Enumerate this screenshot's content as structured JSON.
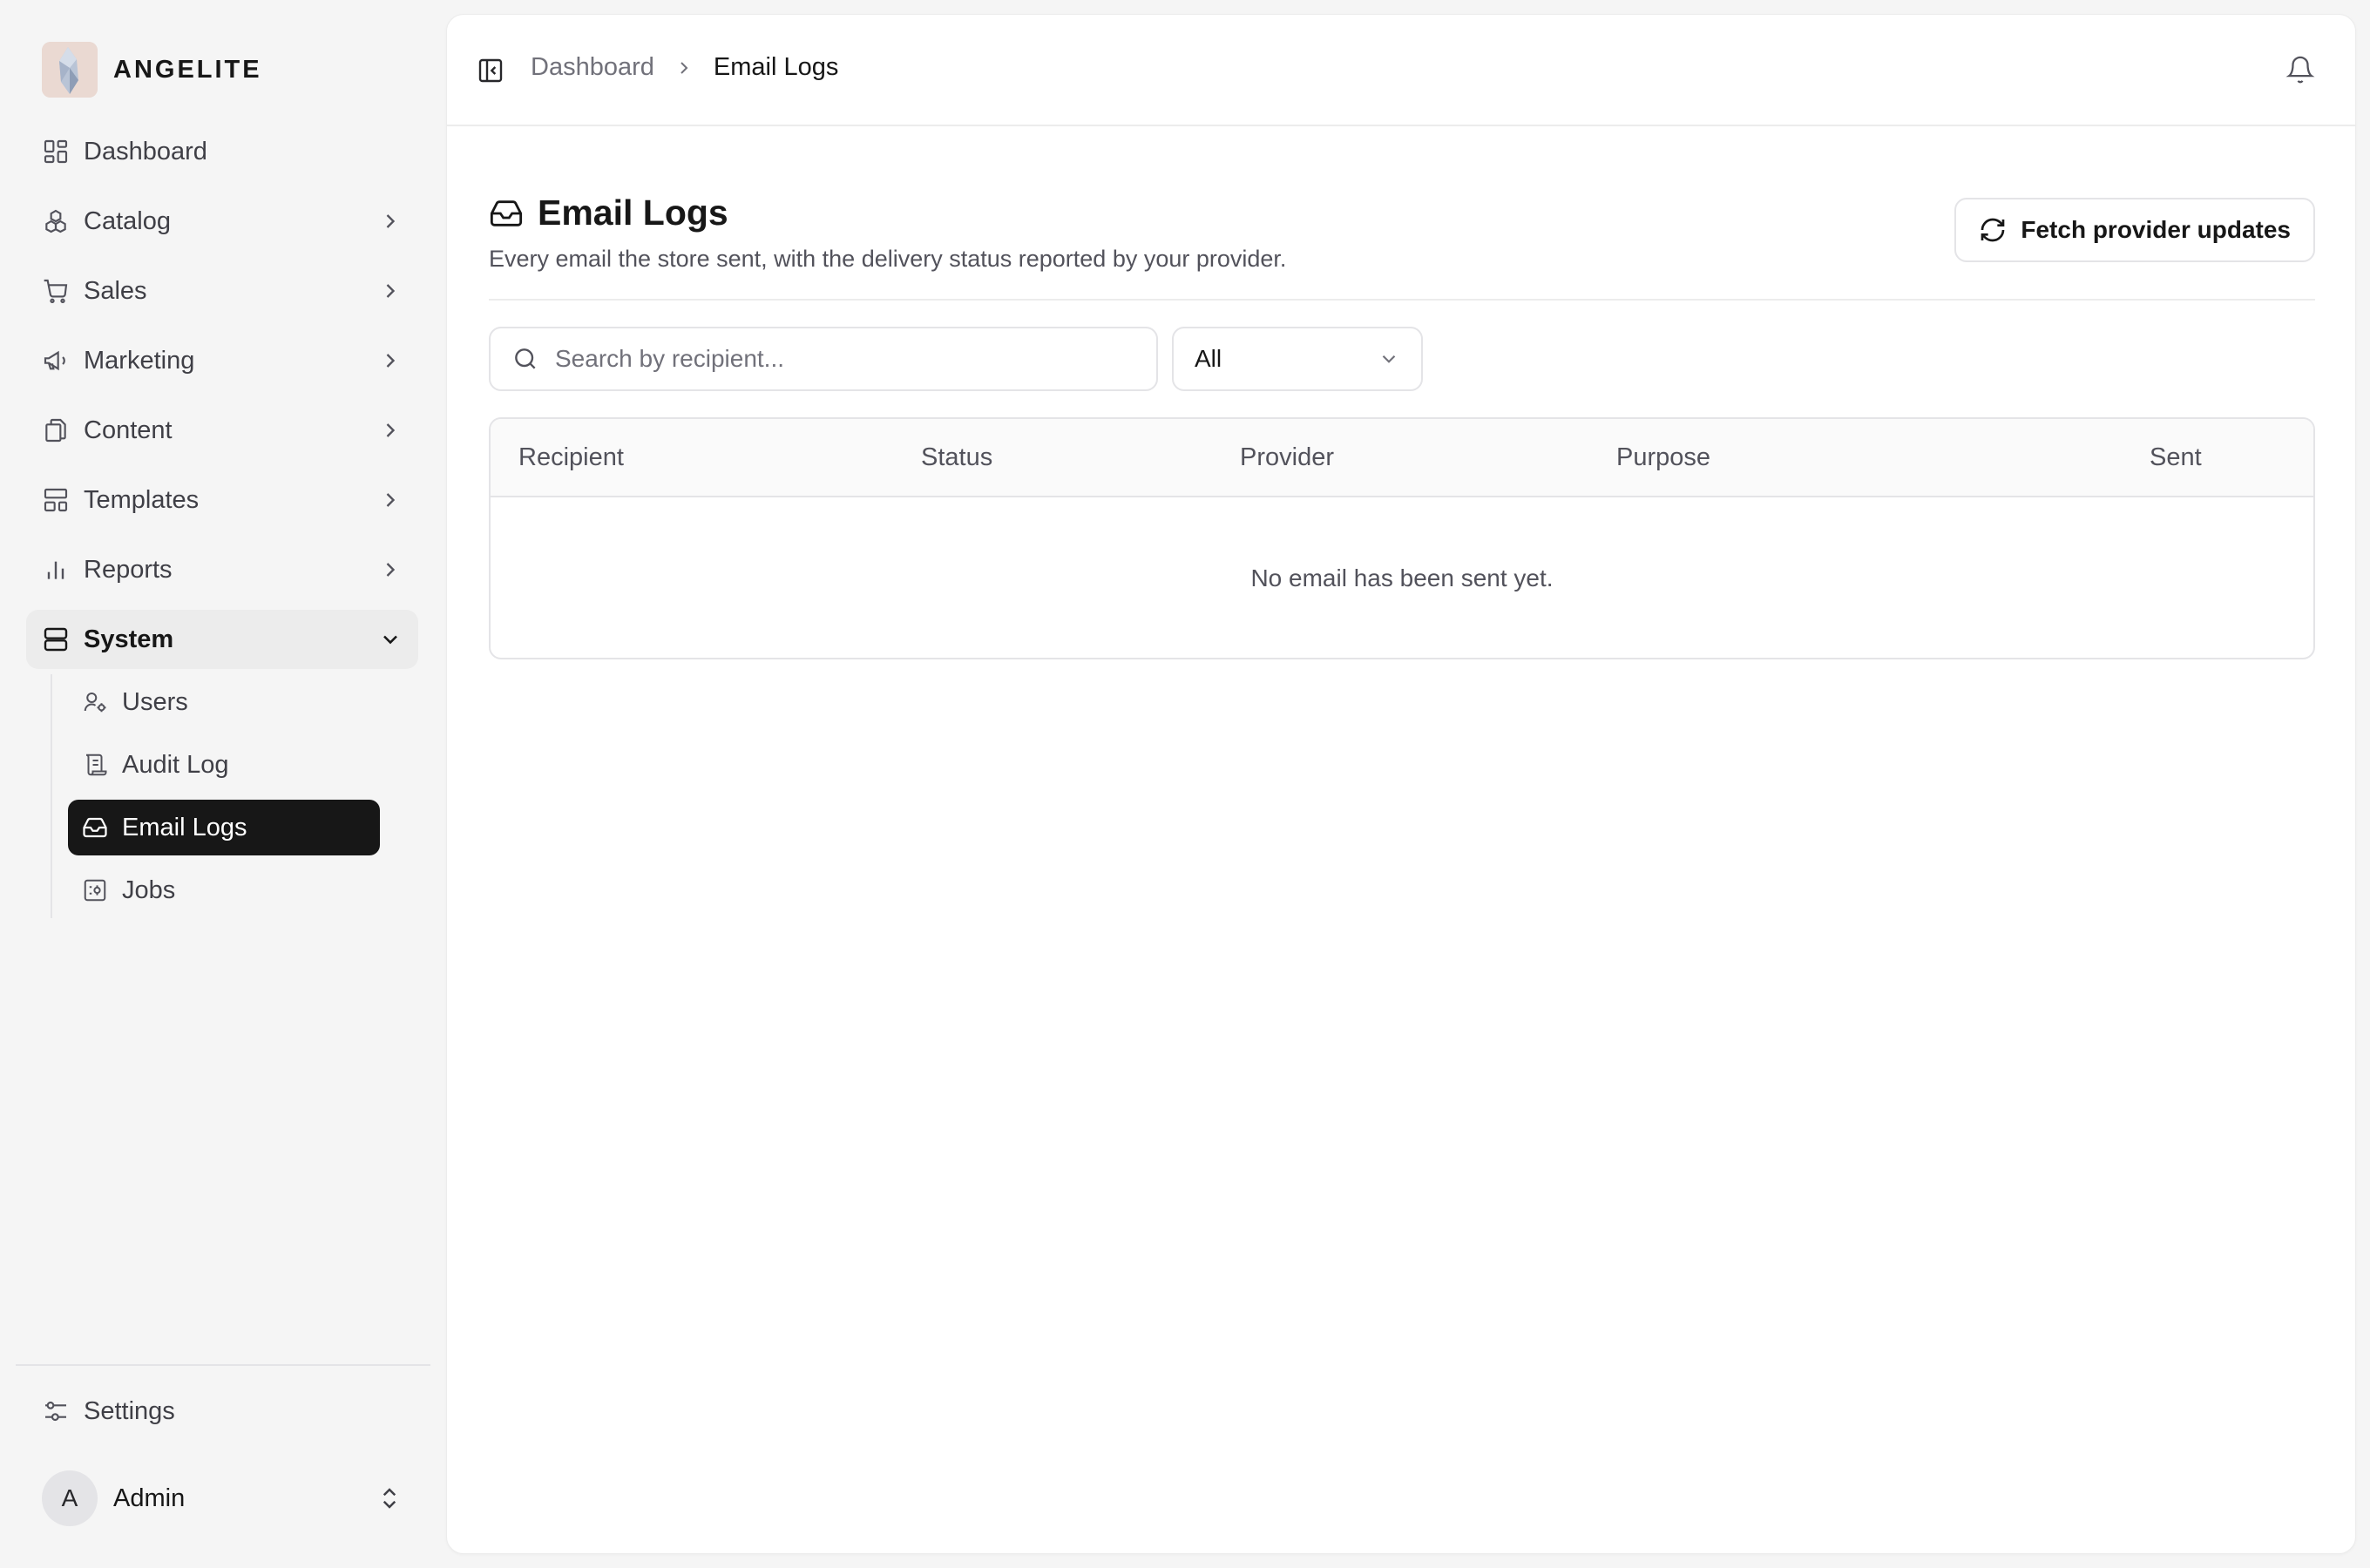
{
  "brand": {
    "name": "ANGELITE"
  },
  "sidebar": {
    "items": [
      {
        "label": "Dashboard",
        "icon": "dashboard-icon",
        "has_children": false
      },
      {
        "label": "Catalog",
        "icon": "catalog-icon",
        "has_children": true
      },
      {
        "label": "Sales",
        "icon": "cart-icon",
        "has_children": true
      },
      {
        "label": "Marketing",
        "icon": "megaphone-icon",
        "has_children": true
      },
      {
        "label": "Content",
        "icon": "files-icon",
        "has_children": true
      },
      {
        "label": "Templates",
        "icon": "templates-icon",
        "has_children": true
      },
      {
        "label": "Reports",
        "icon": "bar-chart-icon",
        "has_children": true
      },
      {
        "label": "System",
        "icon": "server-icon",
        "has_children": true,
        "expanded": true
      }
    ],
    "system_children": [
      {
        "label": "Users",
        "icon": "users-icon"
      },
      {
        "label": "Audit Log",
        "icon": "scroll-icon"
      },
      {
        "label": "Email Logs",
        "icon": "inbox-icon",
        "active": true
      },
      {
        "label": "Jobs",
        "icon": "jobs-icon"
      }
    ],
    "settings_label": "Settings",
    "user": {
      "initial": "A",
      "name": "Admin"
    }
  },
  "breadcrumb": {
    "parent": "Dashboard",
    "current": "Email Logs"
  },
  "page": {
    "title": "Email Logs",
    "subtitle": "Every email the store sent, with the delivery status reported by your provider.",
    "fetch_button": "Fetch provider updates"
  },
  "filters": {
    "search_placeholder": "Search by recipient...",
    "status_selected": "All"
  },
  "table": {
    "columns": [
      "Recipient",
      "Status",
      "Provider",
      "Purpose",
      "Sent"
    ],
    "empty_message": "No email has been sent yet."
  },
  "colors": {
    "active_bg": "#171717",
    "background": "#f5f5f5",
    "card": "#ffffff",
    "border": "#e4e4e7"
  }
}
